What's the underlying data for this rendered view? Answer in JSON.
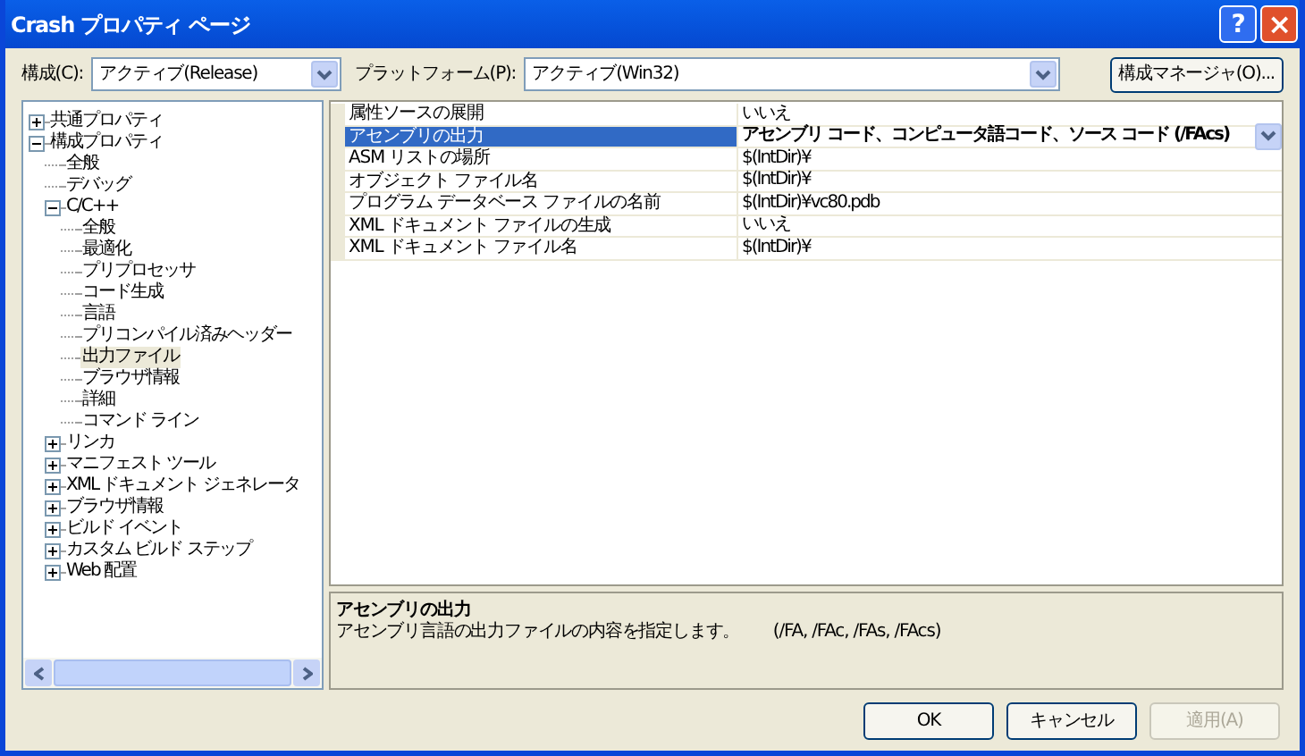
{
  "window": {
    "title": "Crash プロパティ ページ",
    "help": "?",
    "close": "×"
  },
  "toolbar": {
    "config_label": "構成(C):",
    "config_value": "アクティブ(Release)",
    "platform_label": "プラットフォーム(P):",
    "platform_value": "アクティブ(Win32)",
    "manager_button": "構成マネージャ(O)..."
  },
  "tree": [
    {
      "label": "共通プロパティ",
      "expanded": false,
      "selected": false
    },
    {
      "label": "構成プロパティ",
      "expanded": true,
      "selected": false,
      "children": [
        {
          "label": "全般",
          "selected": false
        },
        {
          "label": "デバッグ",
          "selected": false
        },
        {
          "label": "C/C++",
          "expanded": true,
          "selected": false,
          "children": [
            {
              "label": "全般",
              "selected": false
            },
            {
              "label": "最適化",
              "selected": false
            },
            {
              "label": "プリプロセッサ",
              "selected": false
            },
            {
              "label": "コード生成",
              "selected": false
            },
            {
              "label": "言語",
              "selected": false
            },
            {
              "label": "プリコンパイル済みヘッダー",
              "selected": false
            },
            {
              "label": "出力ファイル",
              "selected": true
            },
            {
              "label": "ブラウザ情報",
              "selected": false
            },
            {
              "label": "詳細",
              "selected": false
            },
            {
              "label": "コマンド ライン",
              "selected": false
            }
          ]
        },
        {
          "label": "リンカ",
          "expanded": false,
          "selected": false
        },
        {
          "label": "マニフェスト ツール",
          "expanded": false,
          "selected": false
        },
        {
          "label": "XML ドキュメント ジェネレータ",
          "expanded": false,
          "selected": false
        },
        {
          "label": "ブラウザ情報",
          "expanded": false,
          "selected": false
        },
        {
          "label": "ビルド イベント",
          "expanded": false,
          "selected": false
        },
        {
          "label": "カスタム ビルド ステップ",
          "expanded": false,
          "selected": false
        },
        {
          "label": "Web 配置",
          "expanded": false,
          "selected": false
        }
      ]
    }
  ],
  "properties": [
    {
      "name": "属性ソースの展開",
      "value": "いいえ",
      "selected": false
    },
    {
      "name": "アセンブリの出力",
      "value": "アセンブリ コード、コンピュータ語コード、ソース コード (/FAcs)",
      "selected": true
    },
    {
      "name": "ASM リストの場所",
      "value": "$(IntDir)¥",
      "selected": false
    },
    {
      "name": "オブジェクト ファイル名",
      "value": "$(IntDir)¥",
      "selected": false
    },
    {
      "name": "プログラム データベース ファイルの名前",
      "value": "$(IntDir)¥vc80.pdb",
      "selected": false
    },
    {
      "name": "XML ドキュメント ファイルの生成",
      "value": "いいえ",
      "selected": false
    },
    {
      "name": "XML ドキュメント ファイル名",
      "value": "$(IntDir)¥",
      "selected": false
    }
  ],
  "description": {
    "title": "アセンブリの出力",
    "text": "アセンブリ言語の出力ファイルの内容を指定します。　　(/FA, /FAc, /FAs, /FAcs)"
  },
  "buttons": [
    {
      "label": "OK",
      "disabled": false
    },
    {
      "label": "キャンセル",
      "disabled": false
    },
    {
      "label": "適用(A)",
      "disabled": true
    }
  ]
}
